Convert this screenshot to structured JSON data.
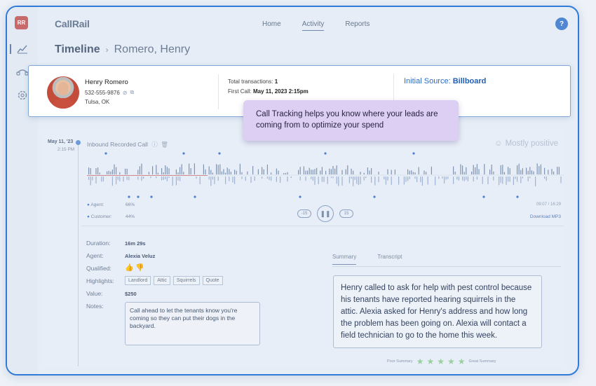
{
  "app": {
    "logo_initials": "RR",
    "brand": "CallRail",
    "nav": [
      "Home",
      "Activity",
      "Reports"
    ],
    "active_nav": "Activity",
    "help": "?"
  },
  "breadcrumb": {
    "title": "Timeline",
    "separator": "›",
    "current": "Romero, Henry"
  },
  "contact": {
    "name": "Henry Romero",
    "phone": "532-555-9876",
    "location": "Tulsa, OK",
    "total_transactions_label": "Total transactions:",
    "total_transactions_value": "1",
    "first_call_label": "First Call:",
    "first_call_value": "May 11, 2023 2:15pm",
    "source_label": "Initial Source:",
    "source_value": "Billboard"
  },
  "tooltip": {
    "text": "Call Tracking helps you know where your leads are coming from to optimize your spend"
  },
  "call": {
    "date": "May 11, '23",
    "time": "2:15 PM",
    "title": "Inbound Recorded Call",
    "sentiment": "Mostly positive",
    "agent_legend": "Agent:",
    "agent_pct": "66%",
    "customer_legend": "Customer:",
    "customer_pct": "44%",
    "back": "-15",
    "play": "❚❚",
    "forward": "15",
    "duration_display": "09:07 / 16:29",
    "download": "Download MP3"
  },
  "details": {
    "duration_label": "Duration:",
    "duration": "16m 29s",
    "agent_label": "Agent:",
    "agent": "Alexia Veluz",
    "qualified_label": "Qualified:",
    "highlights_label": "Highlights:",
    "highlights": [
      "Landlord",
      "Attic",
      "Squirrels",
      "Quote"
    ],
    "value_label": "Value:",
    "value": "$250",
    "notes_label": "Notes:",
    "notes": "Call ahead to let the tenants know you're coming so they can put their dogs in the backyard."
  },
  "summary": {
    "tabs": [
      "Summary",
      "Transcript"
    ],
    "active_tab": "Summary",
    "text": "Henry called to ask for help with pest control because his tenants have reported hearing squirrels in the attic. Alexia asked for Henry's address and how long the problem has been going on. Alexia will contact a field technician to go to the home this week.",
    "poor_label": "Poor Summary",
    "great_label": "Great Summary",
    "stars": 5
  }
}
